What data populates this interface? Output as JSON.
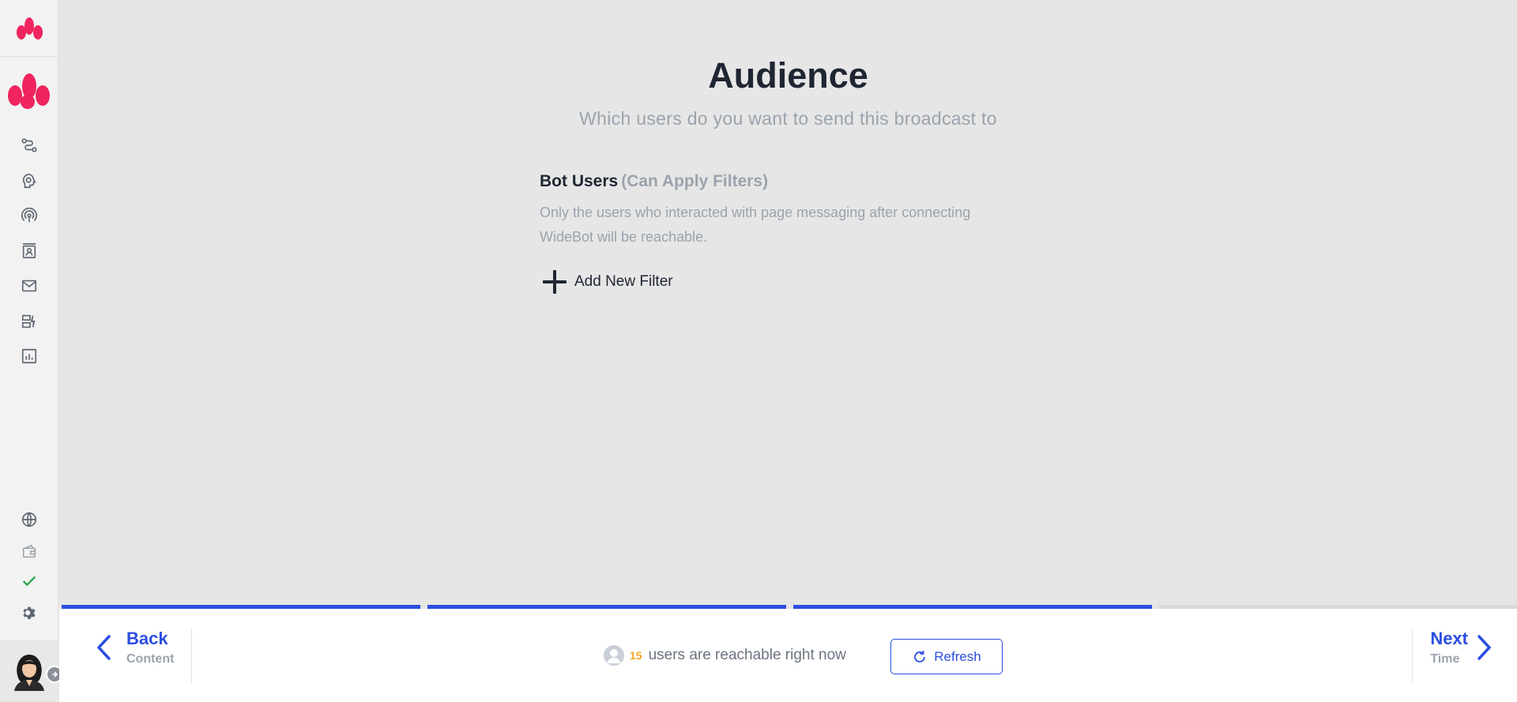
{
  "page": {
    "title": "Audience",
    "subtitle": "Which users do you want to send this broadcast to"
  },
  "section": {
    "title": "Bot Users",
    "hint": "(Can Apply Filters)",
    "description": "Only the users who interacted with page messaging after connecting WideBot will be reachable.",
    "add_filter_label": "Add New Filter"
  },
  "progress": {
    "steps_total": 4,
    "steps_complete": 3
  },
  "footer": {
    "back_label": "Back",
    "back_sub": "Content",
    "next_label": "Next",
    "next_sub": "Time",
    "reachable_count": "15",
    "reachable_text": "users are reachable right now",
    "refresh_label": "Refresh"
  },
  "colors": {
    "accent": "#2b4ee0",
    "brand": "#f0245e",
    "count": "#f5a623",
    "success": "#2fa84f"
  },
  "sidebar": {
    "icons": [
      "flow-icon",
      "bot-brain-icon",
      "broadcast-icon",
      "contacts-icon",
      "mail-icon",
      "widgets-icon",
      "analytics-icon"
    ],
    "bottom_icons": [
      "globe-icon",
      "wallet-icon",
      "check-icon",
      "gear-icon"
    ]
  }
}
